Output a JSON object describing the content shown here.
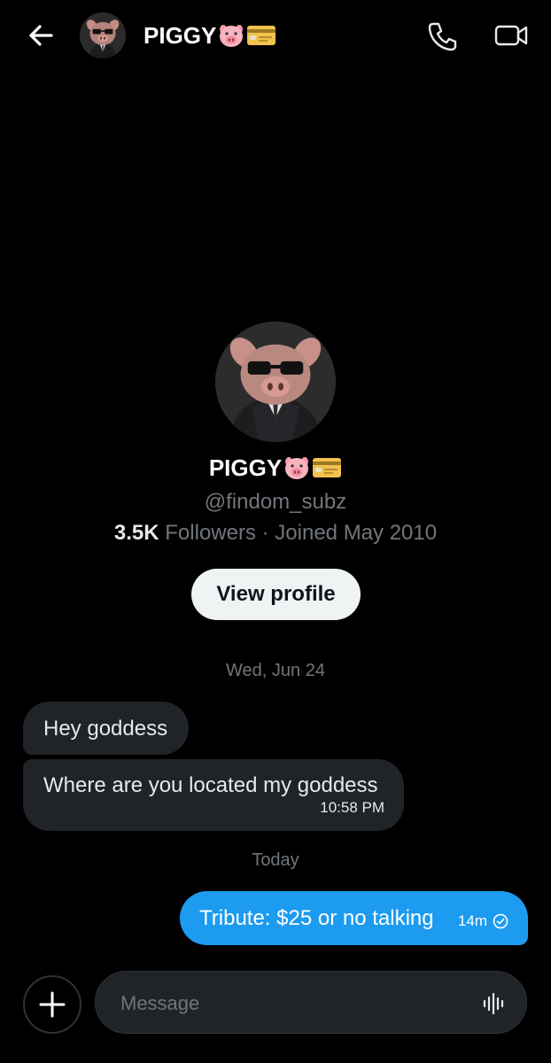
{
  "header": {
    "title": "PIGGY",
    "title_emojis": [
      "pig-face-emoji",
      "credit-card-emoji"
    ],
    "back_icon": "arrow-left-icon",
    "call_icon": "phone-icon",
    "video_icon": "video-camera-icon"
  },
  "profile": {
    "name": "PIGGY",
    "handle": "@findom_subz",
    "followers_count": "3.5K",
    "followers_label": "Followers",
    "separator": " · ",
    "joined": "Joined May 2010",
    "view_profile_label": "View profile"
  },
  "conversation": {
    "date_1": "Wed, Jun 24",
    "messages_in": [
      {
        "text": "Hey goddess"
      },
      {
        "text": "Where are you located my goddess",
        "time": "10:58 PM"
      }
    ],
    "date_2": "Today",
    "message_out": {
      "text": "Tribute: $25 or no talking",
      "time": "14m",
      "status_icon": "check-circle-icon"
    }
  },
  "composer": {
    "placeholder": "Message",
    "add_icon": "plus-icon",
    "voice_icon": "waveform-icon"
  },
  "colors": {
    "background": "#000000",
    "accent": "#1d9bf0",
    "bubble_in": "#202327",
    "muted_text": "#71767b"
  }
}
